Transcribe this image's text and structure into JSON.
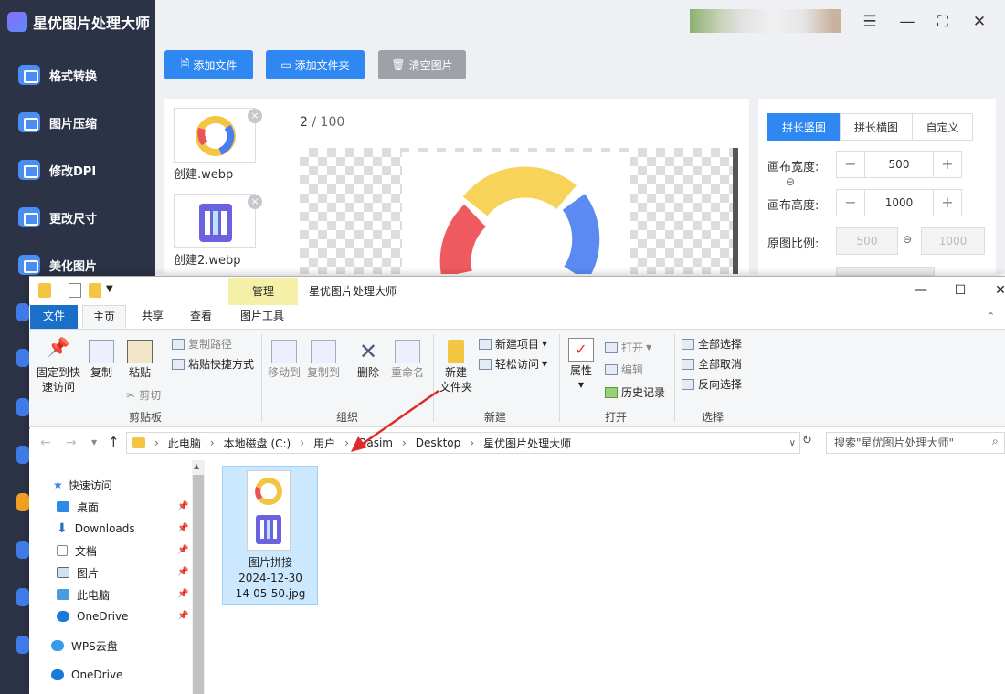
{
  "app": {
    "title": "星优图片处理大师",
    "sidebar": [
      "格式转换",
      "图片压缩",
      "修改DPI",
      "更改尺寸",
      "美化图片"
    ],
    "toolbar": {
      "add_file": "添加文件",
      "add_folder": "添加文件夹",
      "clear": "清空图片"
    },
    "files": [
      {
        "name": "创建.webp"
      },
      {
        "name": "创建2.webp"
      }
    ],
    "page_current": "2",
    "page_total": "100",
    "settings": {
      "tabs": [
        "拼长竖图",
        "拼长横图",
        "自定义"
      ],
      "canvas_width_label": "画布宽度:",
      "canvas_width": "500",
      "canvas_height_label": "画布高度:",
      "canvas_height": "1000",
      "ratio_label": "原图比例:",
      "ratio_w": "500",
      "ratio_h": "1000"
    },
    "accent": "#2f88f2"
  },
  "explorer": {
    "window_title": "星优图片处理大师",
    "manage_tab": "管理",
    "tabs": [
      "文件",
      "主页",
      "共享",
      "查看",
      "图片工具"
    ],
    "ribbon": {
      "pin": [
        "固定到快",
        "速访问"
      ],
      "copy": "复制",
      "paste": "粘贴",
      "copy_path": "复制路径",
      "paste_shortcut": "粘贴快捷方式",
      "cut": "剪切",
      "clipboard": "剪贴板",
      "move_to": "移动到",
      "copy_to": "复制到",
      "delete": "删除",
      "rename": "重命名",
      "organize": "组织",
      "new_folder": [
        "新建",
        "文件夹"
      ],
      "new_item": "新建项目",
      "easy_access": "轻松访问",
      "new": "新建",
      "properties": "属性",
      "open": "打开",
      "edit": "编辑",
      "history": "历史记录",
      "open_group": "打开",
      "select_all": "全部选择",
      "select_none": "全部取消",
      "invert": "反向选择",
      "select_group": "选择"
    },
    "path": [
      "此电脑",
      "本地磁盘 (C:)",
      "用户",
      "Qasim",
      "Desktop",
      "星优图片处理大师"
    ],
    "search_placeholder": "搜索\"星优图片处理大师\"",
    "nav": {
      "quick_access": "快速访问",
      "items": [
        "桌面",
        "Downloads",
        "文档",
        "图片",
        "此电脑",
        "OneDrive"
      ],
      "wps": "WPS云盘",
      "onedrive": "OneDrive"
    },
    "file": {
      "line1": "图片拼接",
      "line2": "2024-12-30",
      "line3": "14-05-50.jpg"
    }
  }
}
